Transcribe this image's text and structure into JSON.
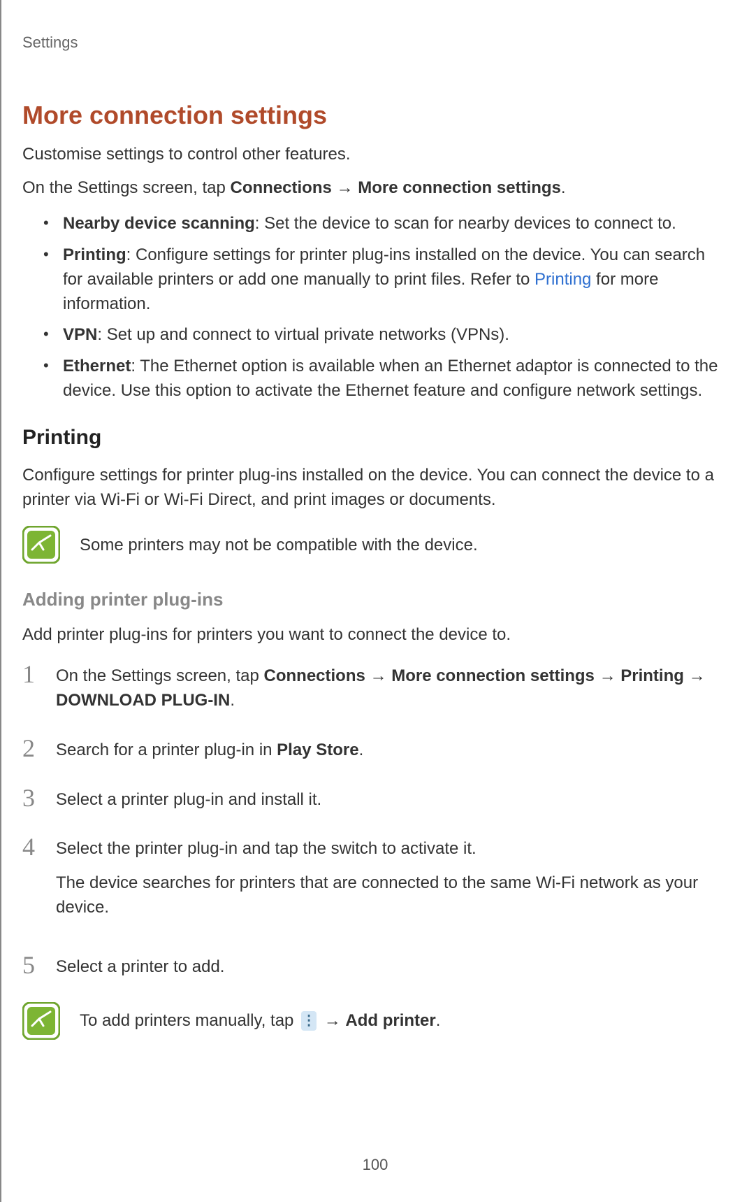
{
  "header": {
    "section": "Settings"
  },
  "title": "More connection settings",
  "intro": "Customise settings to control other features.",
  "path": {
    "prefix": "On the Settings screen, tap ",
    "p1": "Connections",
    "arrow": " → ",
    "p2": "More connection settings",
    "suffix": "."
  },
  "bullets": [
    {
      "term": "Nearby device scanning",
      "desc": ": Set the device to scan for nearby devices to connect to."
    },
    {
      "term": "Printing",
      "desc_pre": ": Configure settings for printer plug-ins installed on the device. You can search for available printers or add one manually to print files. Refer to ",
      "link": "Printing",
      "desc_post": " for more information."
    },
    {
      "term": "VPN",
      "desc": ": Set up and connect to virtual private networks (VPNs)."
    },
    {
      "term": "Ethernet",
      "desc": ": The Ethernet option is available when an Ethernet adaptor is connected to the device. Use this option to activate the Ethernet feature and configure network settings."
    }
  ],
  "printing": {
    "heading": "Printing",
    "body": "Configure settings for printer plug-ins installed on the device. You can connect the device to a printer via Wi-Fi or Wi-Fi Direct, and print images or documents.",
    "note": "Some printers may not be compatible with the device."
  },
  "plugins": {
    "heading": "Adding printer plug-ins",
    "intro": "Add printer plug-ins for printers you want to connect the device to.",
    "steps": {
      "s1": {
        "num": "1",
        "pre": "On the Settings screen, tap ",
        "p1": "Connections",
        "a1": " → ",
        "p2": "More connection settings",
        "a2": " → ",
        "p3": "Printing",
        "a3": " → ",
        "p4": "DOWNLOAD PLUG-IN",
        "suffix": "."
      },
      "s2": {
        "num": "2",
        "pre": "Search for a printer plug-in in ",
        "b": "Play Store",
        "suffix": "."
      },
      "s3": {
        "num": "3",
        "text": "Select a printer plug-in and install it."
      },
      "s4": {
        "num": "4",
        "line1": "Select the printer plug-in and tap the switch to activate it.",
        "line2": "The device searches for printers that are connected to the same Wi-Fi network as your device."
      },
      "s5": {
        "num": "5",
        "text": "Select a printer to add."
      }
    },
    "note2": {
      "pre": "To add printers manually, tap ",
      "arrow": " → ",
      "b": "Add printer",
      "suffix": "."
    }
  },
  "page_number": "100"
}
